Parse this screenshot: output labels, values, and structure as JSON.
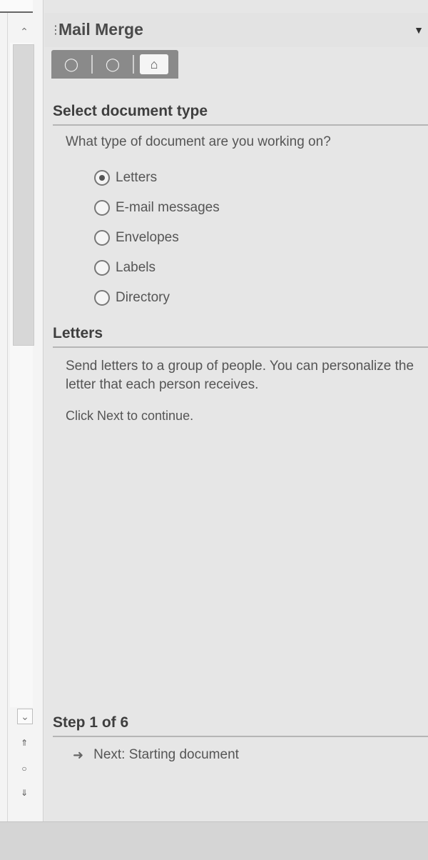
{
  "pane": {
    "title": "Mail Merge",
    "menu_icon": "dropdown-arrow-icon",
    "tabs": [
      "back-icon",
      "forward-icon",
      "home-icon"
    ]
  },
  "sections": {
    "select_type": "Select document type",
    "question": "What type of document are you working on?",
    "options": [
      {
        "label": "Letters",
        "checked": true
      },
      {
        "label": "E-mail messages",
        "checked": false
      },
      {
        "label": "Envelopes",
        "checked": false
      },
      {
        "label": "Labels",
        "checked": false
      },
      {
        "label": "Directory",
        "checked": false
      }
    ],
    "letters_title": "Letters",
    "letters_desc": "Send letters to a group of people. You can personalize the letter that each person receives.",
    "click_next": "Click Next to continue.",
    "step": "Step 1 of 6",
    "next_link": "Next: Starting document"
  }
}
